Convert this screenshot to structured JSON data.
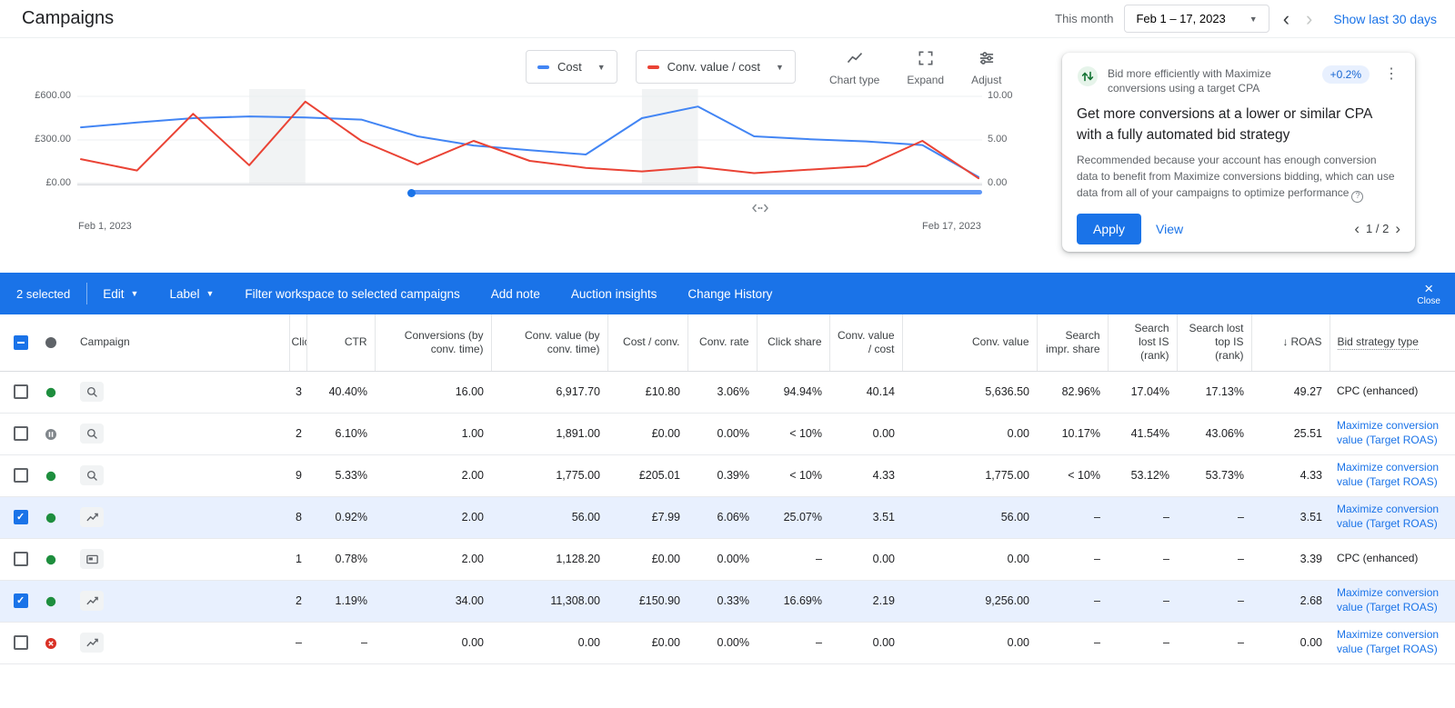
{
  "header": {
    "title": "Campaigns",
    "period_label": "This month",
    "date_range": "Feb 1 – 17, 2023",
    "show_last_link": "Show last 30 days"
  },
  "chart": {
    "metric_selectors": [
      {
        "label": "Cost",
        "color": "#4285f4"
      },
      {
        "label": "Conv. value / cost",
        "color": "#ea4335"
      }
    ],
    "tools": [
      {
        "id": "chart-type",
        "label": "Chart type"
      },
      {
        "id": "expand",
        "label": "Expand"
      },
      {
        "id": "adjust",
        "label": "Adjust"
      }
    ],
    "y_left_labels": [
      "£600.00",
      "£300.00",
      "£0.00"
    ],
    "y_right_labels": [
      "10.00",
      "5.00",
      "0.00"
    ],
    "x_axis_start": "Feb 1, 2023",
    "x_axis_end": "Feb 17, 2023"
  },
  "chart_data": {
    "type": "line",
    "x": [
      "Feb 1",
      "Feb 2",
      "Feb 3",
      "Feb 4",
      "Feb 5",
      "Feb 6",
      "Feb 7",
      "Feb 8",
      "Feb 9",
      "Feb 10",
      "Feb 11",
      "Feb 12",
      "Feb 13",
      "Feb 14",
      "Feb 15",
      "Feb 16",
      "Feb 17"
    ],
    "series": [
      {
        "name": "Cost",
        "axis": "left",
        "color": "#4285f4",
        "values": [
          387,
          420,
          450,
          462,
          455,
          440,
          325,
          262,
          230,
          200,
          450,
          530,
          325,
          305,
          290,
          265,
          45
        ]
      },
      {
        "name": "Conv. value / cost",
        "axis": "right",
        "color": "#ea4335",
        "values": [
          2.8,
          1.5,
          8.0,
          2.1,
          9.4,
          4.9,
          2.2,
          4.9,
          2.6,
          1.8,
          1.4,
          1.9,
          1.2,
          1.6,
          2.0,
          4.9,
          0.6
        ]
      }
    ],
    "y_left_range": [
      0,
      600
    ],
    "y_right_range": [
      0,
      10
    ],
    "y_left_ticks": [
      "£0.00",
      "£300.00",
      "£600.00"
    ],
    "y_right_ticks": [
      "0.00",
      "5.00",
      "10.00"
    ],
    "weekend_bands": [
      [
        3,
        4
      ],
      [
        10,
        11
      ]
    ],
    "legend_position": "top",
    "grid": true
  },
  "recommendation": {
    "title": "Bid more efficiently with Maximize conversions using a target CPA",
    "uplift_badge": "+0.2%",
    "headline": "Get more conversions at a lower or similar CPA with a fully automated bid strategy",
    "body": "Recommended because your account has enough conversion data to benefit from Maximize conversions bidding, which can use data from all of your campaigns to optimize performance",
    "apply_label": "Apply",
    "view_label": "View",
    "pagination": "1 / 2"
  },
  "action_bar": {
    "selected_count": "2 selected",
    "edit_label": "Edit",
    "label_label": "Label",
    "links": [
      "Filter workspace to selected campaigns",
      "Add note",
      "Auction insights",
      "Change History"
    ],
    "close_label": "Close"
  },
  "table": {
    "columns": [
      {
        "id": "select",
        "label": ""
      },
      {
        "id": "status",
        "label": ""
      },
      {
        "id": "campaign",
        "label": "Campaign"
      },
      {
        "id": "clicks",
        "label": "Clicks"
      },
      {
        "id": "ctr",
        "label": "CTR"
      },
      {
        "id": "conversions",
        "label": "Conversions (by conv. time)"
      },
      {
        "id": "conv_value_time",
        "label": "Conv. value (by conv. time)"
      },
      {
        "id": "cost_per_conv",
        "label": "Cost / conv."
      },
      {
        "id": "conv_rate",
        "label": "Conv. rate"
      },
      {
        "id": "click_share",
        "label": "Click share"
      },
      {
        "id": "conv_value_cost",
        "label": "Conv. value / cost"
      },
      {
        "id": "conv_value",
        "label": "Conv. value"
      },
      {
        "id": "search_impr_share",
        "label": "Search impr. share"
      },
      {
        "id": "search_lost_is",
        "label": "Search lost IS (rank)"
      },
      {
        "id": "search_lost_top_is",
        "label": "Search lost top IS (rank)"
      },
      {
        "id": "roas",
        "label": "ROAS",
        "sorted": "desc"
      },
      {
        "id": "bid_strategy",
        "label": "Bid strategy type"
      }
    ],
    "rows": [
      {
        "selected": false,
        "status": "enabled",
        "type_icon": "search-icon",
        "campaign_name": "",
        "cells": {
          "clicks": "3",
          "ctr": "40.40%",
          "conversions": "16.00",
          "conv_value_time": "6,917.70",
          "cost_per_conv": "£10.80",
          "conv_rate": "3.06%",
          "click_share": "94.94%",
          "conv_value_cost": "40.14",
          "conv_value": "5,636.50",
          "search_impr_share": "82.96%",
          "search_lost_is": "17.04%",
          "search_lost_top_is": "17.13%",
          "roas": "49.27",
          "bid_strategy": "CPC (enhanced)"
        },
        "bid_is_link": false
      },
      {
        "selected": false,
        "status": "paused",
        "type_icon": "search-icon",
        "campaign_name": "",
        "cells": {
          "clicks": "2",
          "ctr": "6.10%",
          "conversions": "1.00",
          "conv_value_time": "1,891.00",
          "cost_per_conv": "£0.00",
          "conv_rate": "0.00%",
          "click_share": "< 10%",
          "conv_value_cost": "0.00",
          "conv_value": "0.00",
          "search_impr_share": "10.17%",
          "search_lost_is": "41.54%",
          "search_lost_top_is": "43.06%",
          "roas": "25.51",
          "bid_strategy": "Maximize conversion value (Target ROAS)"
        },
        "bid_is_link": true
      },
      {
        "selected": false,
        "status": "enabled",
        "type_icon": "search-icon",
        "campaign_name": "",
        "cells": {
          "clicks": "9",
          "ctr": "5.33%",
          "conversions": "2.00",
          "conv_value_time": "1,775.00",
          "cost_per_conv": "£205.01",
          "conv_rate": "0.39%",
          "click_share": "< 10%",
          "conv_value_cost": "4.33",
          "conv_value": "1,775.00",
          "search_impr_share": "< 10%",
          "search_lost_is": "53.12%",
          "search_lost_top_is": "53.73%",
          "roas": "4.33",
          "bid_strategy": "Maximize conversion value (Target ROAS)"
        },
        "bid_is_link": true
      },
      {
        "selected": true,
        "status": "enabled",
        "type_icon": "chart-icon",
        "campaign_name": "",
        "cells": {
          "clicks": "8",
          "ctr": "0.92%",
          "conversions": "2.00",
          "conv_value_time": "56.00",
          "cost_per_conv": "£7.99",
          "conv_rate": "6.06%",
          "click_share": "25.07%",
          "conv_value_cost": "3.51",
          "conv_value": "56.00",
          "search_impr_share": "–",
          "search_lost_is": "–",
          "search_lost_top_is": "–",
          "roas": "3.51",
          "bid_strategy": "Maximize conversion value (Target ROAS)"
        },
        "bid_is_link": true
      },
      {
        "selected": false,
        "status": "enabled",
        "type_icon": "display-icon",
        "campaign_name": "",
        "cells": {
          "clicks": "1",
          "ctr": "0.78%",
          "conversions": "2.00",
          "conv_value_time": "1,128.20",
          "cost_per_conv": "£0.00",
          "conv_rate": "0.00%",
          "click_share": "–",
          "conv_value_cost": "0.00",
          "conv_value": "0.00",
          "search_impr_share": "–",
          "search_lost_is": "–",
          "search_lost_top_is": "–",
          "roas": "3.39",
          "bid_strategy": "CPC (enhanced)"
        },
        "bid_is_link": false
      },
      {
        "selected": true,
        "status": "enabled",
        "type_icon": "chart-icon",
        "campaign_name": "",
        "cells": {
          "clicks": "2",
          "ctr": "1.19%",
          "conversions": "34.00",
          "conv_value_time": "11,308.00",
          "cost_per_conv": "£150.90",
          "conv_rate": "0.33%",
          "click_share": "16.69%",
          "conv_value_cost": "2.19",
          "conv_value": "9,256.00",
          "search_impr_share": "–",
          "search_lost_is": "–",
          "search_lost_top_is": "–",
          "roas": "2.68",
          "bid_strategy": "Maximize conversion value (Target ROAS)"
        },
        "bid_is_link": true
      },
      {
        "selected": false,
        "status": "removed",
        "type_icon": "chart-icon",
        "campaign_name": "",
        "cells": {
          "clicks": "–",
          "ctr": "–",
          "conversions": "0.00",
          "conv_value_time": "0.00",
          "cost_per_conv": "£0.00",
          "conv_rate": "0.00%",
          "click_share": "–",
          "conv_value_cost": "0.00",
          "conv_value": "0.00",
          "search_impr_share": "–",
          "search_lost_is": "–",
          "search_lost_top_is": "–",
          "roas": "0.00",
          "bid_strategy": "Maximize conversion value (Target ROAS)"
        },
        "bid_is_link": true
      }
    ]
  }
}
